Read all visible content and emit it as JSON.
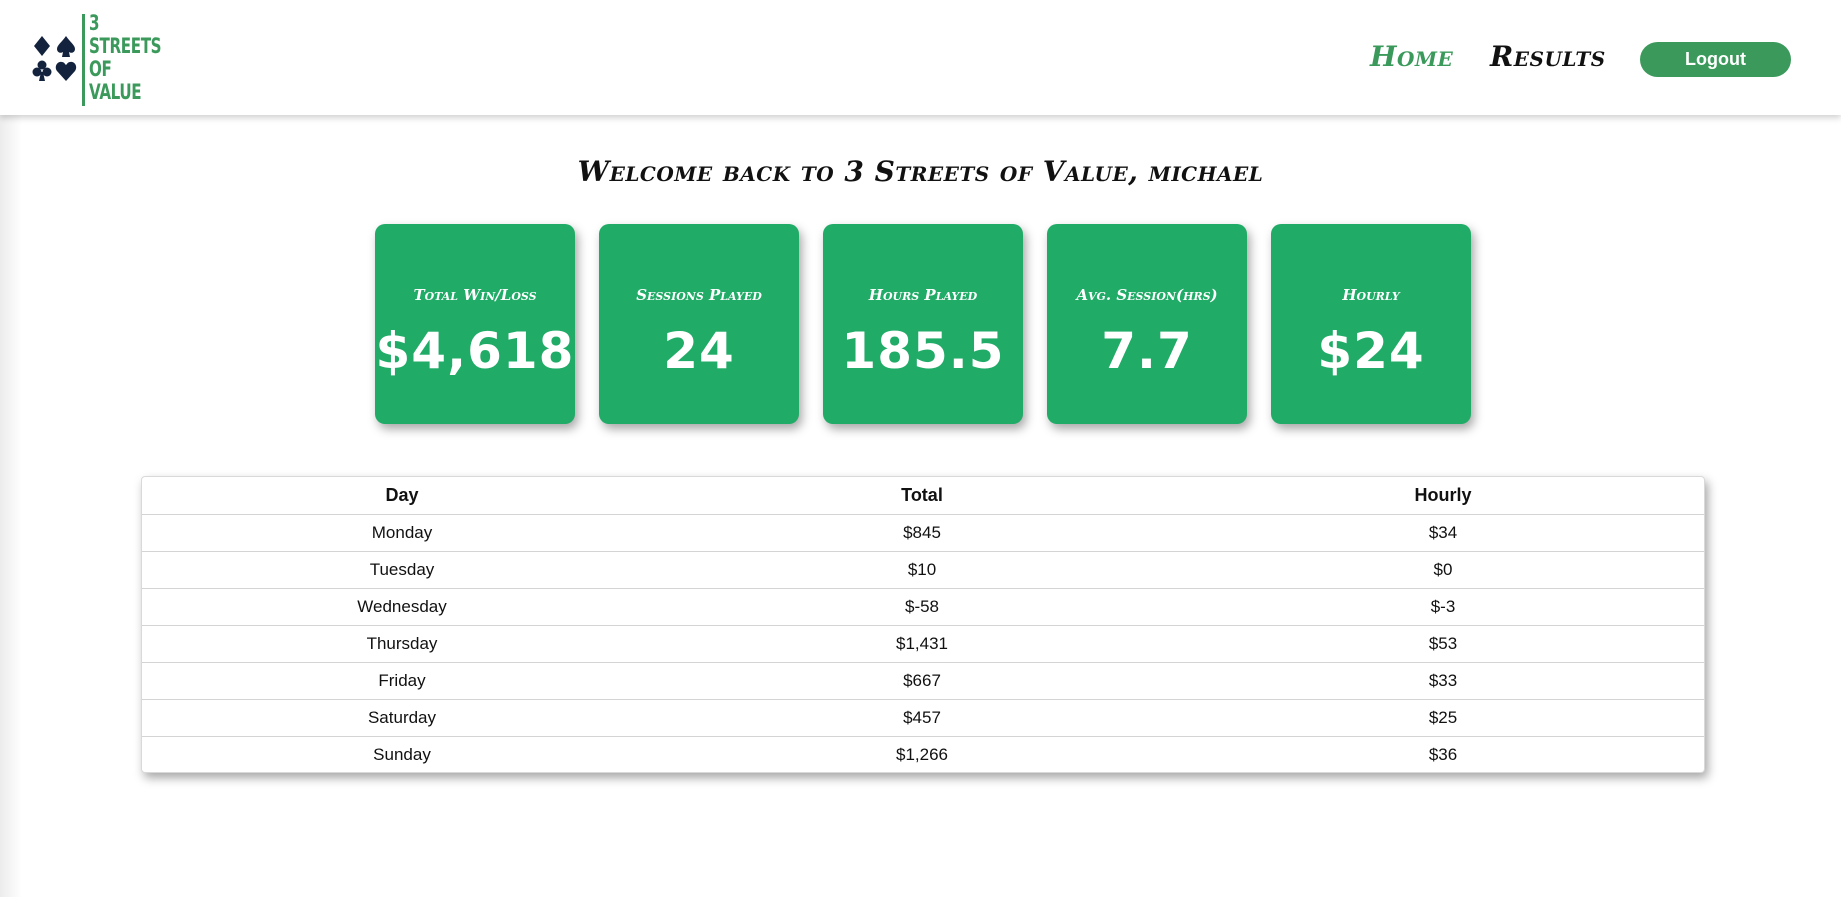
{
  "header": {
    "logo_lines": [
      "3",
      "STREETS",
      "OF",
      "VALUE"
    ],
    "nav": {
      "home": "Home",
      "results": "Results"
    },
    "logout_label": "Logout"
  },
  "welcome": "Welcome back to 3 Streets of Value, michael",
  "stats": [
    {
      "label": "Total Win/Loss",
      "value": "$4,618"
    },
    {
      "label": "Sessions Played",
      "value": "24"
    },
    {
      "label": "Hours Played",
      "value": "185.5"
    },
    {
      "label": "Avg. Session(hrs)",
      "value": "7.7"
    },
    {
      "label": "Hourly",
      "value": "$24"
    }
  ],
  "table": {
    "headers": [
      "Day",
      "Total",
      "Hourly"
    ],
    "rows": [
      [
        "Monday",
        "$845",
        "$34"
      ],
      [
        "Tuesday",
        "$10",
        "$0"
      ],
      [
        "Wednesday",
        "$-58",
        "$-3"
      ],
      [
        "Thursday",
        "$1,431",
        "$53"
      ],
      [
        "Friday",
        "$667",
        "$33"
      ],
      [
        "Saturday",
        "$457",
        "$25"
      ],
      [
        "Sunday",
        "$1,266",
        "$36"
      ]
    ]
  },
  "colors": {
    "brand_green": "#3b9a5b",
    "card_green": "#20ab67",
    "suit_navy": "#14233d"
  }
}
